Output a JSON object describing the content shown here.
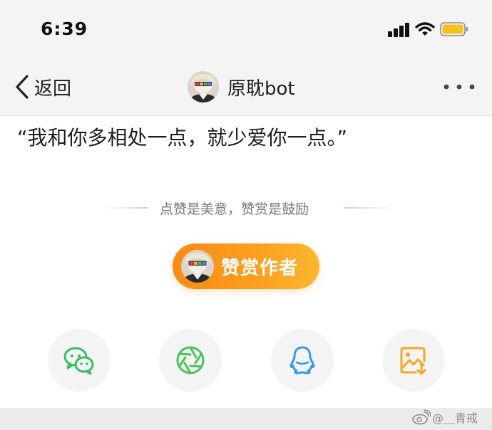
{
  "status_bar": {
    "time": "6:39",
    "icons": [
      "cellular-signal-icon",
      "wifi-icon",
      "battery-icon"
    ],
    "battery_color": "#f7c21d"
  },
  "nav": {
    "back_icon": "chevron-left-icon",
    "back_label": "返回",
    "author_name": "原耽bot",
    "more_icon": "more-dots-icon"
  },
  "article": {
    "quote": "“我和你多相处一点，就少爱你一点。”"
  },
  "reward": {
    "divider_text": "点赞是美意，赞赏是鼓励",
    "button_label": "赞赏作者",
    "button_color": "#fb9a1e"
  },
  "share": {
    "items": [
      {
        "icon": "wechat-icon",
        "color": "#3dbb63"
      },
      {
        "icon": "moments-icon",
        "color": "#4cc25d"
      },
      {
        "icon": "qq-icon",
        "color": "#2e9bea"
      },
      {
        "icon": "save-image-icon",
        "color": "#f6a623"
      }
    ]
  },
  "watermark": {
    "text": "@＿青戒"
  }
}
